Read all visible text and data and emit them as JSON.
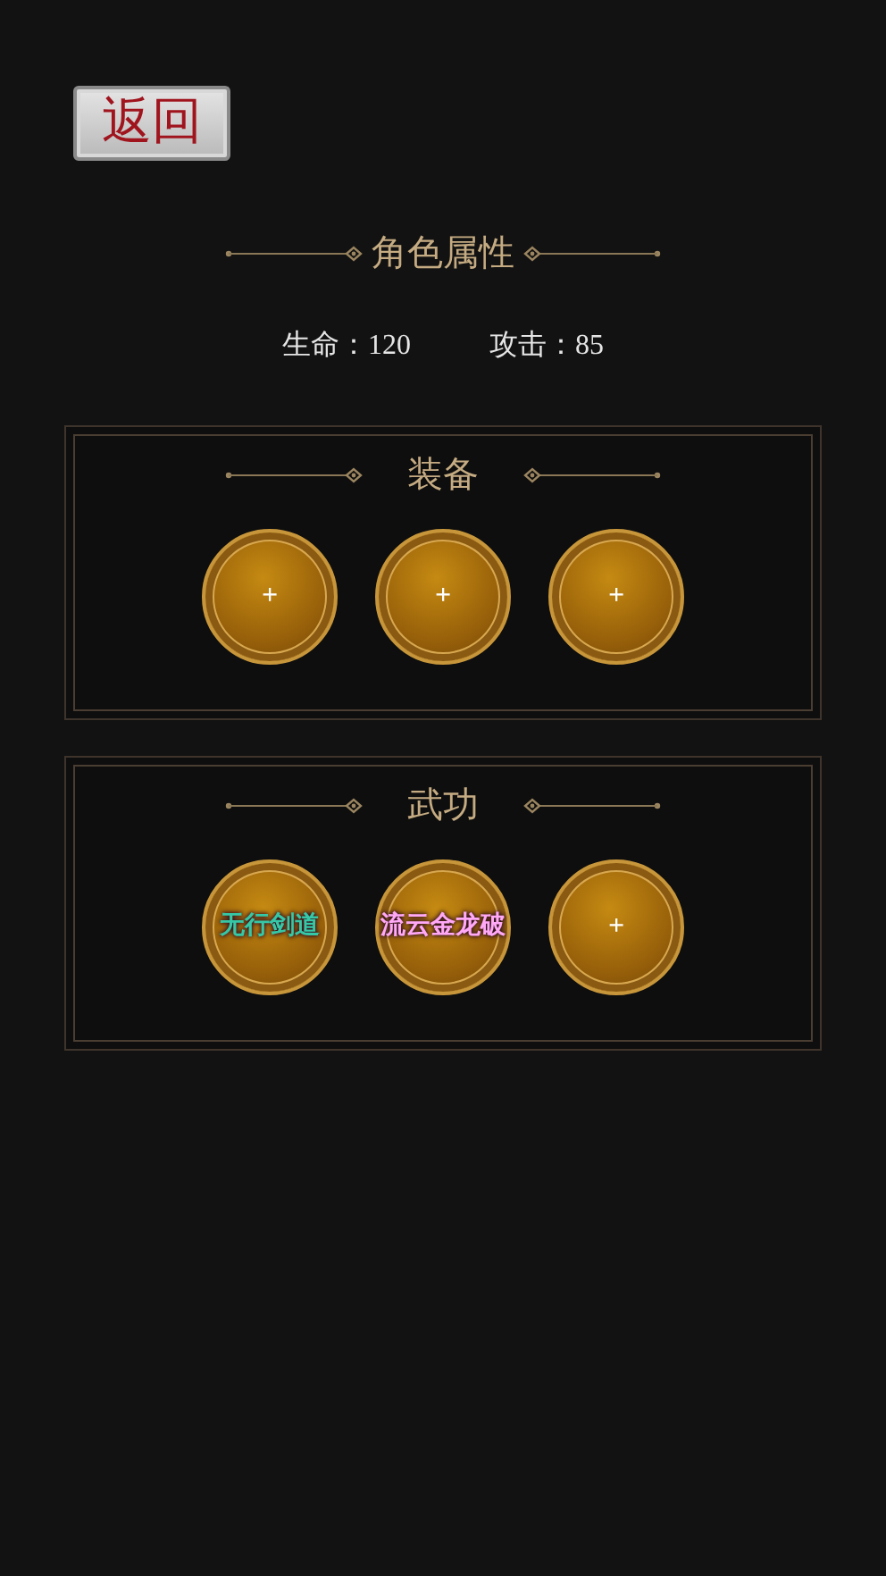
{
  "back_button": {
    "label": "返回"
  },
  "header": {
    "title": "角色属性"
  },
  "stats": [
    {
      "label": "生命：120"
    },
    {
      "label": "攻击：85"
    }
  ],
  "panels": [
    {
      "title": "装备",
      "slots": [
        {
          "kind": "empty",
          "label": "+"
        },
        {
          "kind": "empty",
          "label": "+"
        },
        {
          "kind": "empty",
          "label": "+"
        }
      ]
    },
    {
      "title": "武功",
      "slots": [
        {
          "kind": "skill",
          "label": "无行剑道",
          "color": "#35c7a6"
        },
        {
          "kind": "skill",
          "label": "流云金龙破",
          "color": "#ffa8f6"
        },
        {
          "kind": "empty",
          "label": "+"
        }
      ]
    }
  ]
}
